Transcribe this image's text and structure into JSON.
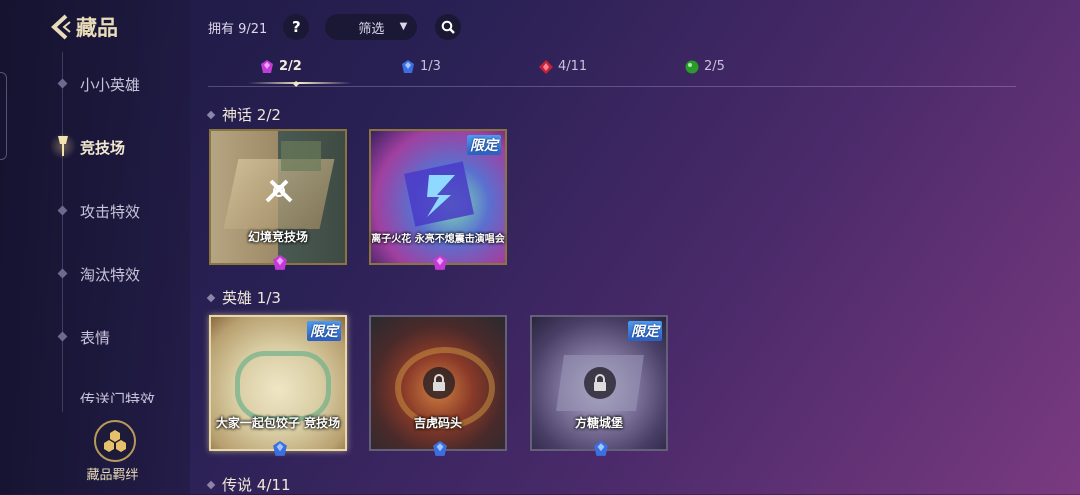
{
  "header": {
    "title": "藏品",
    "owned_label": "拥有 9/21",
    "help_label": "?",
    "filter_label": "筛选"
  },
  "sidebar": {
    "items": [
      {
        "label": "小小英雄",
        "active": false
      },
      {
        "label": "竞技场",
        "active": true
      },
      {
        "label": "攻击特效",
        "active": false
      },
      {
        "label": "淘汰特效",
        "active": false
      },
      {
        "label": "表情",
        "active": false
      },
      {
        "label": "传送门特效",
        "active": false
      }
    ],
    "bond_label": "藏品羁绊"
  },
  "rarity_tabs": [
    {
      "label": "2/2",
      "gem": "purple-gem-icon",
      "color": "#c23bd6"
    },
    {
      "label": "1/3",
      "gem": "blue-gem-icon",
      "color": "#3b6fe0"
    },
    {
      "label": "4/11",
      "gem": "red-gem-icon",
      "color": "#c2233a"
    },
    {
      "label": "2/5",
      "gem": "green-gem-icon",
      "color": "#2a9a2a"
    }
  ],
  "sections": [
    {
      "title": "神话",
      "count": "2/2",
      "cards": [
        {
          "name": "幻境竞技场",
          "limited": "",
          "locked": false
        },
        {
          "name": "离子火花 永亮不熄震击演唱会",
          "limited": "限定",
          "locked": false
        }
      ]
    },
    {
      "title": "英雄",
      "count": "1/3",
      "cards": [
        {
          "name": "大家一起包饺子 竞技场",
          "limited": "限定",
          "locked": false,
          "selected": true
        },
        {
          "name": "吉虎码头",
          "limited": "",
          "locked": true
        },
        {
          "name": "方糖城堡",
          "limited": "限定",
          "locked": true
        }
      ]
    },
    {
      "title": "传说",
      "count": "4/11"
    }
  ]
}
